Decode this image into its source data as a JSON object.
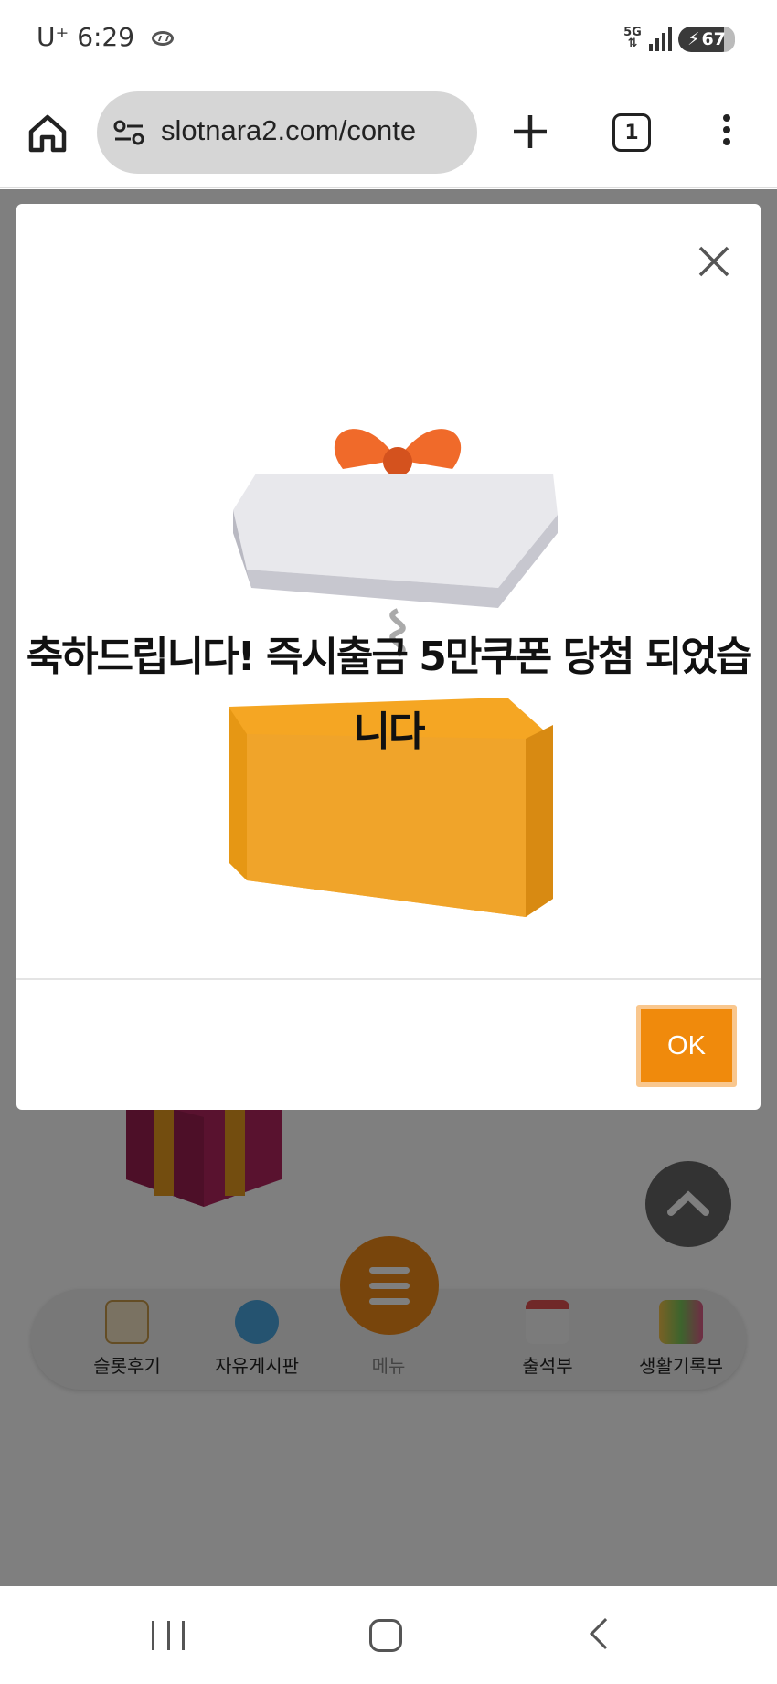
{
  "status_bar": {
    "carrier": "U⁺",
    "time": "6:29",
    "network": "5G",
    "battery": "67",
    "icons": [
      "hyundai-logo-icon",
      "5g-icon",
      "signal-icon",
      "battery-icon"
    ]
  },
  "browser": {
    "url": "slotnara2.com/conte",
    "tab_count": "1",
    "icons": [
      "home-icon",
      "site-settings-icon",
      "plus-icon",
      "more-vert-icon"
    ]
  },
  "modal": {
    "message": "축하드립니다! 즉시출금 5만쿠폰 당첨 되었습니다",
    "ok_label": "OK",
    "icons": [
      "close-icon",
      "open-gift-box-icon"
    ]
  },
  "bottom_nav": {
    "items": [
      {
        "label": "슬롯후기",
        "icon": "review-icon"
      },
      {
        "label": "자유게시판",
        "icon": "chat-icon"
      },
      {
        "label": "메뉴",
        "icon": "menu-icon"
      },
      {
        "label": "출석부",
        "icon": "calendar-icon"
      },
      {
        "label": "생활기록부",
        "icon": "record-icon"
      }
    ]
  },
  "colors": {
    "accent": "#f08a0c",
    "overlay": "rgba(0,0,0,0.5)",
    "ok_border": "#f9c78e"
  }
}
